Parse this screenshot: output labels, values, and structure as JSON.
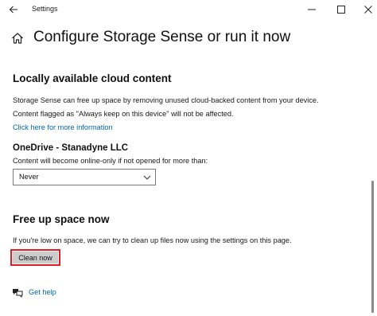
{
  "window": {
    "title": "Settings",
    "controls": {
      "minimize": "minimize-icon",
      "maximize": "maximize-icon",
      "close": "close-icon"
    }
  },
  "page": {
    "title": "Configure Storage Sense or run it now"
  },
  "cloud_content": {
    "heading": "Locally available cloud content",
    "description": "Storage Sense can free up space by removing unused cloud-backed content from your device.",
    "note": "Content flagged as \"Always keep on this device\" will not be affected.",
    "more_info_link": "Click here for more information",
    "onedrive": {
      "label": "OneDrive - Stanadyne LLC",
      "description": "Content will become online-only if not opened for more than:",
      "selected_option": "Never"
    }
  },
  "free_space": {
    "heading": "Free up space now",
    "description": "If you're low on space, we can try to clean up files now using the settings on this page.",
    "button_label": "Clean now"
  },
  "help": {
    "link": "Get help"
  },
  "colors": {
    "link": "#0067c0",
    "highlight_border": "#e51c23",
    "button_bg": "#cccccc"
  }
}
